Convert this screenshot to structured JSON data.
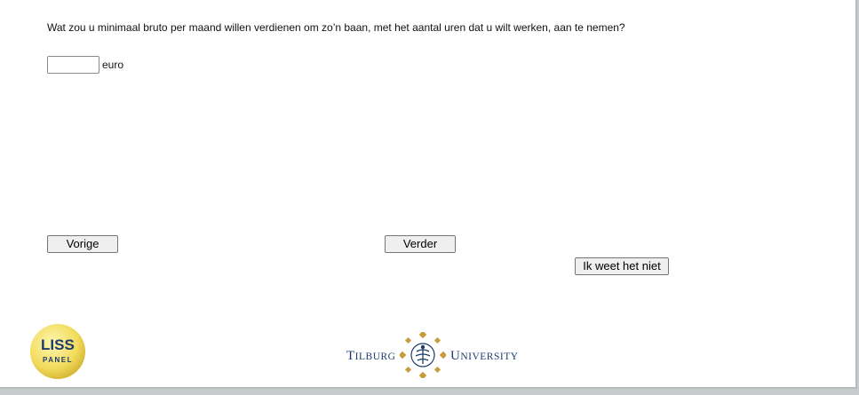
{
  "question": {
    "text": "Wat zou u minimaal bruto per maand willen verdienen om zo’n baan, met het aantal uren dat u wilt werken, aan te nemen?"
  },
  "answer": {
    "value": "",
    "unit": "euro"
  },
  "buttons": {
    "previous": "Vorige",
    "next": "Verder",
    "dont_know": "Ik weet het niet"
  },
  "logos": {
    "liss_top": "LISS",
    "liss_bottom": "PANEL",
    "tilburg_left": "Tilburg",
    "tilburg_right": "University"
  },
  "colors": {
    "liss_yellow": "#f5e06a",
    "tilburg_navy": "#1d3b6d",
    "tilburg_gold": "#c99a3a"
  }
}
